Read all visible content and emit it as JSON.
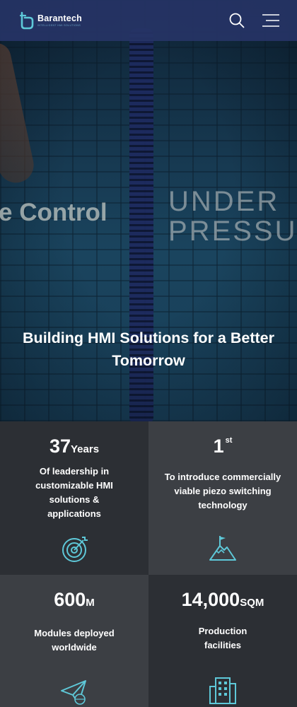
{
  "brand": {
    "name": "Barantech",
    "tagline": "INTELLIGENT HMI SOLUTIONS",
    "accent": "#5ec8d8"
  },
  "header": {
    "search_icon": "search-icon",
    "menu_icon": "hamburger-menu-icon"
  },
  "hero": {
    "overlay_text_left": "e Control",
    "overlay_text_right_line1": "UNDER",
    "overlay_text_right_line2": "PRESSU",
    "title": "Building HMI Solutions for a Better Tomorrow"
  },
  "stats": [
    {
      "number": "37",
      "unit": "Years",
      "superscript": "",
      "description": "Of leadership in customizable HMI solutions & applications",
      "icon": "target-icon"
    },
    {
      "number": "1",
      "unit": "",
      "superscript": "st",
      "description": "To introduce commercially viable piezo switching technology",
      "icon": "mountain-flag-icon"
    },
    {
      "number": "600",
      "unit": "M",
      "superscript": "",
      "description": "Modules deployed worldwide",
      "icon": "paper-plane-globe-icon"
    },
    {
      "number": "14,000",
      "unit": "SQM",
      "superscript": "",
      "description": "Production facilities",
      "icon": "building-icon"
    }
  ]
}
